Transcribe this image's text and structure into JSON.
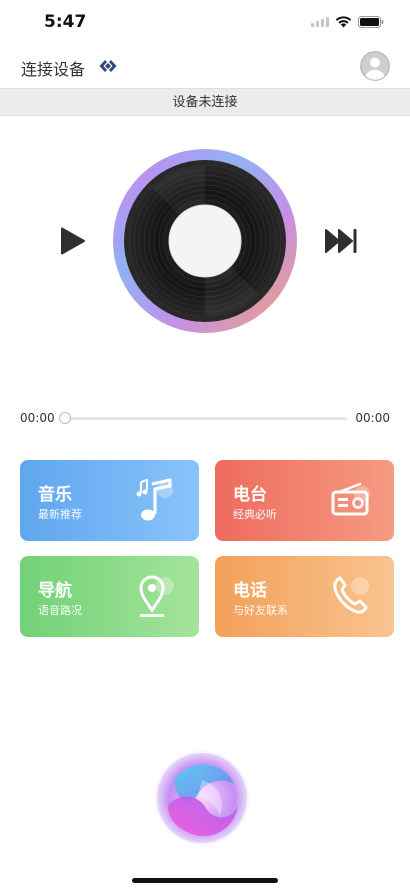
{
  "status_bar": {
    "time": "5:47"
  },
  "header": {
    "title": "连接设备"
  },
  "connection": {
    "status": "设备未连接"
  },
  "player": {
    "current_time": "00:00",
    "total_time": "00:00",
    "progress": 0
  },
  "cards": {
    "music": {
      "title": "音乐",
      "subtitle": "最新推荐"
    },
    "radio": {
      "title": "电台",
      "subtitle": "经典必听"
    },
    "navigation": {
      "title": "导航",
      "subtitle": "语音路况"
    },
    "phone": {
      "title": "电话",
      "subtitle": "与好友联系"
    }
  },
  "colors": {
    "music": "#5fa6ee",
    "radio": "#ee6b5c",
    "navigation": "#72d176",
    "phone": "#f2a059"
  },
  "icons": [
    "wifi-icon",
    "battery-icon",
    "link-icon",
    "avatar-icon",
    "play-icon",
    "next-icon",
    "music-note-icon",
    "radio-icon",
    "location-pin-icon",
    "phone-icon",
    "voice-assistant-icon"
  ]
}
